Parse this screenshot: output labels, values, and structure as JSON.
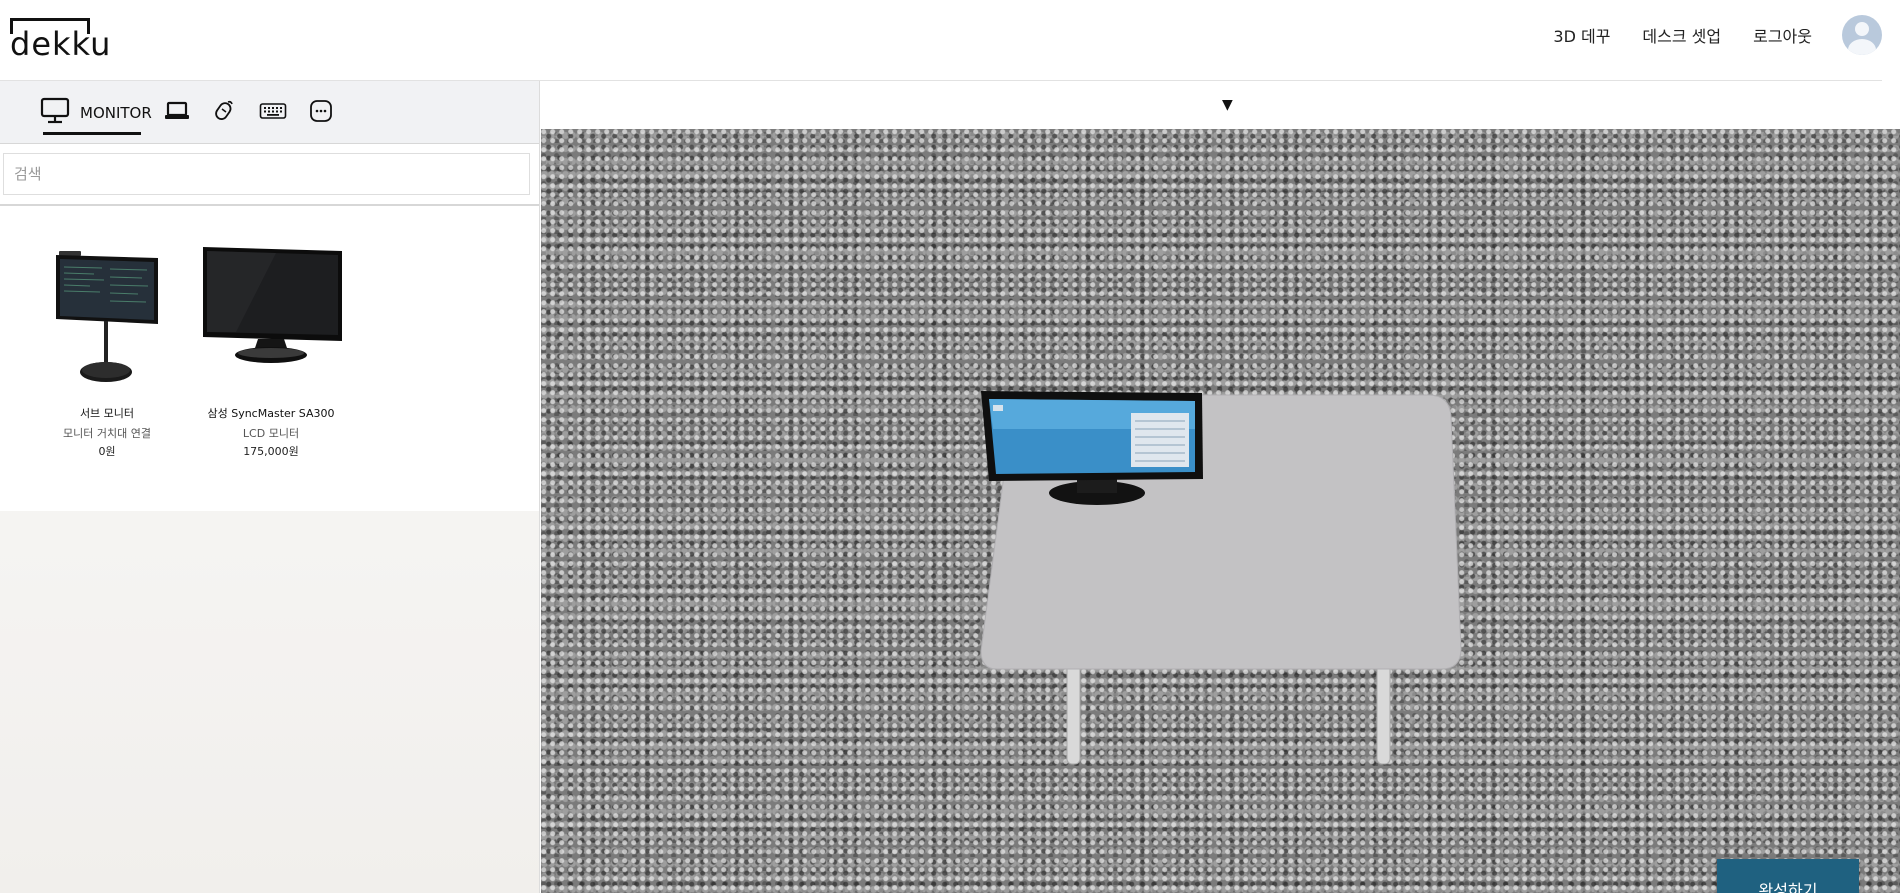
{
  "header": {
    "logo_text": "dekku",
    "nav": [
      "3D 데꾸",
      "데스크 셋업",
      "로그아웃"
    ],
    "avatar_icon": "user-avatar-icon"
  },
  "sidebar": {
    "tabs": [
      {
        "label": "MONITOR",
        "icon": "monitor-icon",
        "active": true
      },
      {
        "label": "",
        "icon": "laptop-icon"
      },
      {
        "label": "",
        "icon": "mouse-icon"
      },
      {
        "label": "",
        "icon": "keyboard-icon"
      },
      {
        "label": "",
        "icon": "more-icon"
      }
    ],
    "search": {
      "placeholder": "검색",
      "value": ""
    },
    "products": [
      {
        "name": "서브 모니터",
        "category": "모니터 거치대 연결",
        "price": "0원"
      },
      {
        "name": "삼성 SyncMaster SA300",
        "category": "LCD 모니터",
        "price": "175,000원"
      }
    ]
  },
  "viewer": {
    "toggle_glyph": "▼",
    "done_label": "완성하기"
  }
}
